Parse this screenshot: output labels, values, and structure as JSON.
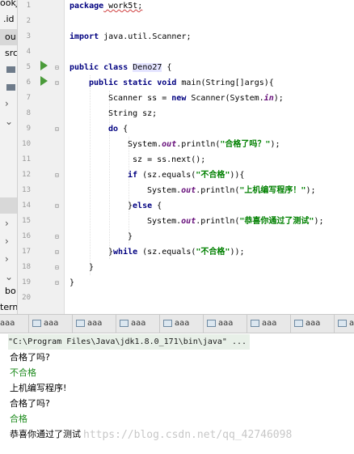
{
  "sidebar": {
    "items": [
      {
        "label": "ookJ",
        "kind": "text"
      },
      {
        "label": ".id",
        "kind": "folder"
      },
      {
        "label": "ou",
        "kind": "folder"
      },
      {
        "label": "src",
        "kind": "folder"
      },
      {
        "label": "",
        "kind": "folder"
      },
      {
        "label": "",
        "kind": "folder"
      },
      {
        "label": "",
        "kind": "arrow"
      },
      {
        "label": "",
        "kind": "arrow"
      },
      {
        "label": "",
        "kind": "arrow"
      },
      {
        "label": "",
        "kind": "arrow"
      },
      {
        "label": "bo",
        "kind": "folder"
      },
      {
        "label": "tern",
        "kind": "text"
      }
    ]
  },
  "gutter": {
    "line_numbers": [
      "1",
      "2",
      "3",
      "4",
      "5",
      "6",
      "7",
      "8",
      "9",
      "10",
      "11",
      "12",
      "13",
      "14",
      "15",
      "16",
      "17",
      "18",
      "19",
      "20"
    ]
  },
  "code": {
    "l1": {
      "kw": "package",
      "rest": " work5t;"
    },
    "l3": {
      "kw": "import",
      "rest": " java.util.Scanner;"
    },
    "l5": {
      "kw": "public class",
      "cls": "Deno27",
      "rest": " {"
    },
    "l6": {
      "kw": "public static void",
      "rest": " main(String[]args){"
    },
    "l7": {
      "a": "Scanner ss = ",
      "kw": "new",
      "b": " Scanner(System.",
      "fld": "in",
      "c": ");"
    },
    "l8": {
      "text": "String sz;"
    },
    "l9": {
      "kw": "do",
      "rest": " {"
    },
    "l10": {
      "a": "System.",
      "fld": "out",
      "b": ".println(",
      "str": "\"合格了吗？\"",
      "c": ");"
    },
    "l11": {
      "text": " sz = ss.next();"
    },
    "l12": {
      "kw": "if",
      "a": " (sz.equals(",
      "str": "\"不合格\"",
      "b": ")){"
    },
    "l13": {
      "a": "System.",
      "fld": "out",
      "b": ".println(",
      "str": "\"上机编写程序！\"",
      "c": ");"
    },
    "l14": {
      "a": "}",
      "kw": "else",
      "b": " {"
    },
    "l15": {
      "a": "System.",
      "fld": "out",
      "b": ".println(",
      "str": "\"恭喜你通过了测试\"",
      "c": ");"
    },
    "l16": {
      "text": "}"
    },
    "l17": {
      "a": "}",
      "kw": "while",
      "b": " (sz.equals(",
      "str": "\"不合格\"",
      "c": "));"
    },
    "l18": {
      "text": "}"
    },
    "l19": {
      "text": "}"
    }
  },
  "run_tabs": [
    {
      "label": "aaa",
      "icon": "console-tab-icon"
    },
    {
      "label": "aaa",
      "icon": "console-tab-icon"
    },
    {
      "label": "aaa",
      "icon": "console-tab-icon"
    },
    {
      "label": "aaa",
      "icon": "console-tab-icon"
    },
    {
      "label": "aaa",
      "icon": "console-tab-icon"
    },
    {
      "label": "aaa",
      "icon": "console-tab-icon"
    },
    {
      "label": "aaa",
      "icon": "console-tab-icon"
    },
    {
      "label": "aaa",
      "icon": "console-tab-icon"
    },
    {
      "label": "aaa",
      "icon": "console-tab-icon"
    }
  ],
  "console": {
    "command": "\"C:\\Program Files\\Java\\jdk1.8.0_171\\bin\\java\" ...",
    "lines": [
      {
        "text": "合格了吗?",
        "kind": "output"
      },
      {
        "text": "不合格",
        "kind": "input"
      },
      {
        "text": "上机编写程序!",
        "kind": "output"
      },
      {
        "text": "合格了吗?",
        "kind": "output"
      },
      {
        "text": "合格",
        "kind": "input"
      },
      {
        "text": "恭喜你通过了测试",
        "kind": "output"
      }
    ],
    "watermark": "https://blog.csdn.net/qq_42746098"
  },
  "colors": {
    "keyword": "#000080",
    "string": "#008000",
    "field": "#660e7a",
    "run_icon": "#4a9b3a",
    "console_input": "#1b8a1b"
  }
}
